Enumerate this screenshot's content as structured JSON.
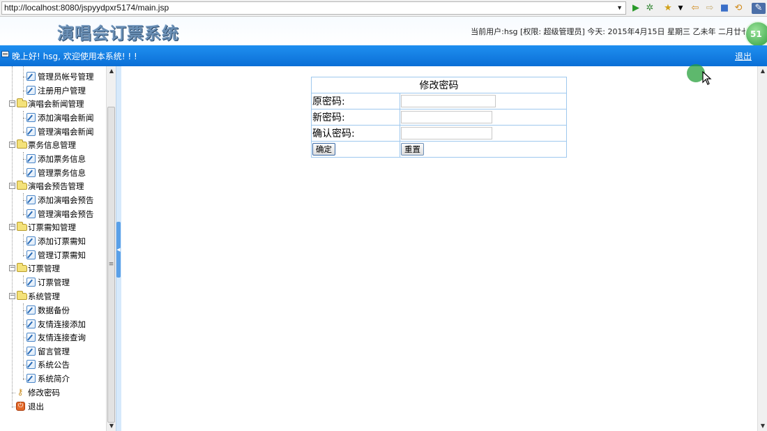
{
  "browser": {
    "url": "http://localhost:8080/jspyydpxr5174/main.jsp"
  },
  "header": {
    "site_title": "演唱会订票系统",
    "user_info": "当前用户:hsg [权限: 超级管理员] 今天: 2015年4月15日 星期三 乙未年 二月廿七",
    "badge": "51"
  },
  "topbar": {
    "greeting": "晚上好! hsg, 欢迎使用本系统! ! !",
    "logout": "退出"
  },
  "sidebar": {
    "items": [
      {
        "label": "管理员帐号管理",
        "kind": "leaf"
      },
      {
        "label": "注册用户管理",
        "kind": "leaf"
      },
      {
        "label": "演唱会新闻管理",
        "kind": "folder"
      },
      {
        "label": "添加演唱会新闻",
        "kind": "leaf"
      },
      {
        "label": "管理演唱会新闻",
        "kind": "leaf"
      },
      {
        "label": "票务信息管理",
        "kind": "folder"
      },
      {
        "label": "添加票务信息",
        "kind": "leaf"
      },
      {
        "label": "管理票务信息",
        "kind": "leaf"
      },
      {
        "label": "演唱会预告管理",
        "kind": "folder"
      },
      {
        "label": "添加演唱会预告",
        "kind": "leaf"
      },
      {
        "label": "管理演唱会预告",
        "kind": "leaf"
      },
      {
        "label": "订票需知管理",
        "kind": "folder"
      },
      {
        "label": "添加订票需知",
        "kind": "leaf"
      },
      {
        "label": "管理订票需知",
        "kind": "leaf"
      },
      {
        "label": "订票管理",
        "kind": "folder"
      },
      {
        "label": "订票管理",
        "kind": "leaf"
      },
      {
        "label": "系统管理",
        "kind": "folder"
      },
      {
        "label": "数据备份",
        "kind": "leaf"
      },
      {
        "label": "友情连接添加",
        "kind": "leaf"
      },
      {
        "label": "友情连接查询",
        "kind": "leaf"
      },
      {
        "label": "留言管理",
        "kind": "leaf"
      },
      {
        "label": "系统公告",
        "kind": "leaf"
      },
      {
        "label": "系统简介",
        "kind": "leaf"
      },
      {
        "label": "修改密码",
        "kind": "key"
      },
      {
        "label": "退出",
        "kind": "exit"
      }
    ]
  },
  "form": {
    "title": "修改密码",
    "old_label": "原密码:",
    "new_label": "新密码:",
    "confirm_label": "确认密码:",
    "old_value": "",
    "new_value": "",
    "confirm_value": "",
    "submit": "确定",
    "reset": "重置"
  }
}
